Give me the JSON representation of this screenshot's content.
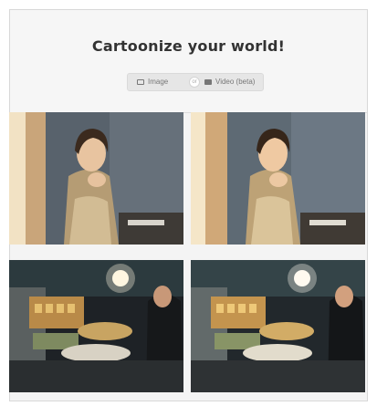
{
  "header": {
    "title": "Cartoonize your world!"
  },
  "mode_switch": {
    "image_label": "Image",
    "or_label": "or",
    "video_label": "Video (beta)"
  },
  "gallery": {
    "items": [
      {
        "kind": "original",
        "subject": "portrait"
      },
      {
        "kind": "cartoonized",
        "subject": "portrait"
      },
      {
        "kind": "original",
        "subject": "food-stall"
      },
      {
        "kind": "cartoonized",
        "subject": "food-stall"
      }
    ]
  },
  "colors": {
    "frame_border": "#d8d8d8",
    "header_bg": "#f6f6f6",
    "switch_bg": "#e6e6e6",
    "title_text": "#333333"
  }
}
